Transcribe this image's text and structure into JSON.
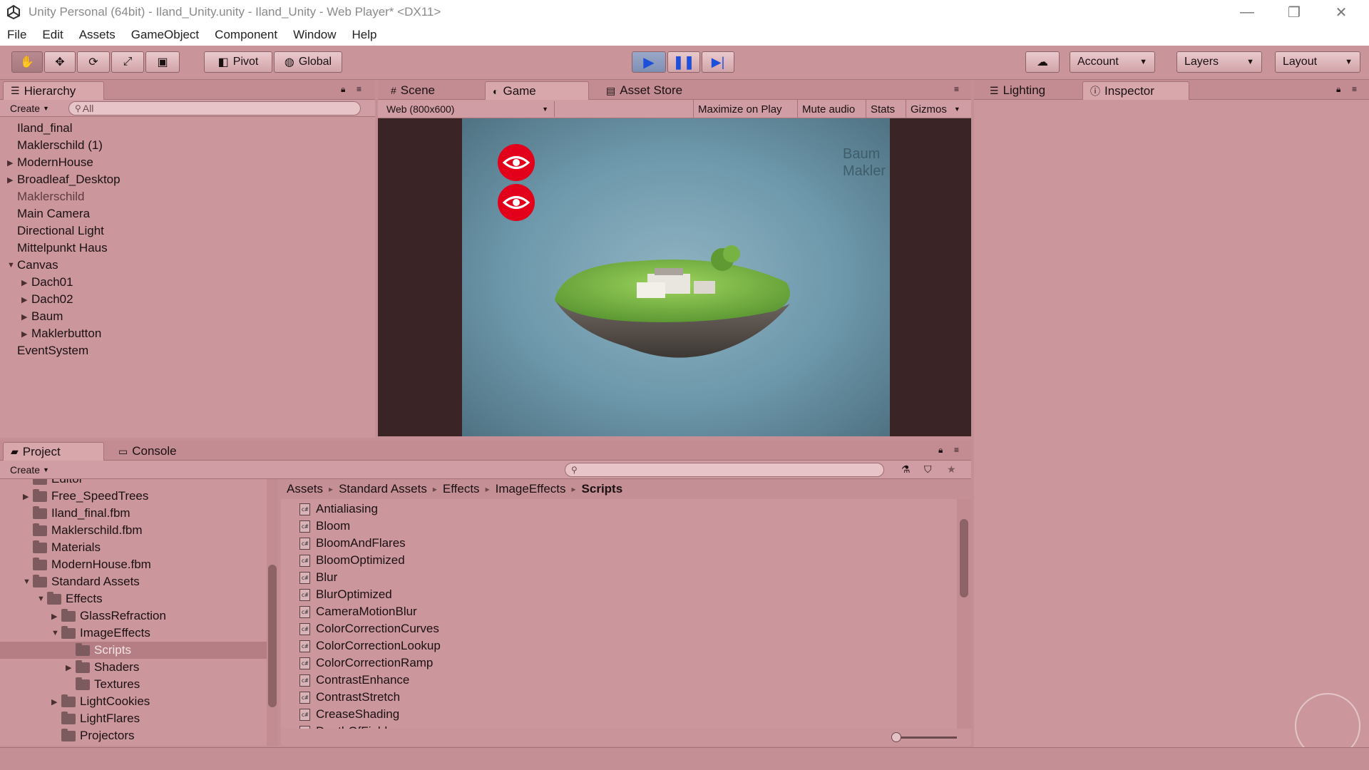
{
  "window": {
    "title": "Unity Personal (64bit) - Iland_Unity.unity - Iland_Unity - Web Player* <DX11>"
  },
  "menu": [
    "File",
    "Edit",
    "Assets",
    "GameObject",
    "Component",
    "Window",
    "Help"
  ],
  "toolbar": {
    "pivot": "Pivot",
    "global": "Global",
    "account": "Account",
    "layers": "Layers",
    "layout": "Layout"
  },
  "tabs": {
    "hierarchy": "Hierarchy",
    "scene": "Scene",
    "game": "Game",
    "asset_store": "Asset Store",
    "lighting": "Lighting",
    "inspector": "Inspector",
    "project": "Project",
    "console": "Console"
  },
  "hierarchy": {
    "create": "Create",
    "search_placeholder": "All",
    "items": [
      {
        "label": "Iland_final",
        "indent": 0,
        "arrow": "",
        "dim": false
      },
      {
        "label": "Maklerschild (1)",
        "indent": 0,
        "arrow": "",
        "dim": false
      },
      {
        "label": "ModernHouse",
        "indent": 0,
        "arrow": "▶",
        "dim": false
      },
      {
        "label": "Broadleaf_Desktop",
        "indent": 0,
        "arrow": "▶",
        "dim": false
      },
      {
        "label": "Maklerschild",
        "indent": 0,
        "arrow": "",
        "dim": true
      },
      {
        "label": "Main Camera",
        "indent": 0,
        "arrow": "",
        "dim": false
      },
      {
        "label": "Directional Light",
        "indent": 0,
        "arrow": "",
        "dim": false
      },
      {
        "label": "Mittelpunkt Haus",
        "indent": 0,
        "arrow": "",
        "dim": false
      },
      {
        "label": "Canvas",
        "indent": 0,
        "arrow": "▼",
        "dim": false
      },
      {
        "label": "Dach01",
        "indent": 1,
        "arrow": "▶",
        "dim": false
      },
      {
        "label": "Dach02",
        "indent": 1,
        "arrow": "▶",
        "dim": false
      },
      {
        "label": "Baum",
        "indent": 1,
        "arrow": "▶",
        "dim": false
      },
      {
        "label": "Maklerbutton",
        "indent": 1,
        "arrow": "▶",
        "dim": false
      },
      {
        "label": "EventSystem",
        "indent": 0,
        "arrow": "",
        "dim": false
      }
    ]
  },
  "game": {
    "resolution": "Web (800x600)",
    "maximize": "Maximize on Play",
    "mute": "Mute audio",
    "stats": "Stats",
    "gizmos": "Gizmos",
    "overlay_line1": "Baum",
    "overlay_line2": "Makler"
  },
  "project": {
    "create": "Create",
    "tree": [
      {
        "label": "Editor",
        "indent": 1,
        "arrow": ""
      },
      {
        "label": "Free_SpeedTrees",
        "indent": 1,
        "arrow": "▶"
      },
      {
        "label": "Iland_final.fbm",
        "indent": 1,
        "arrow": ""
      },
      {
        "label": "Maklerschild.fbm",
        "indent": 1,
        "arrow": ""
      },
      {
        "label": "Materials",
        "indent": 1,
        "arrow": ""
      },
      {
        "label": "ModernHouse.fbm",
        "indent": 1,
        "arrow": ""
      },
      {
        "label": "Standard Assets",
        "indent": 1,
        "arrow": "▼"
      },
      {
        "label": "Effects",
        "indent": 2,
        "arrow": "▼"
      },
      {
        "label": "GlassRefraction",
        "indent": 3,
        "arrow": "▶"
      },
      {
        "label": "ImageEffects",
        "indent": 3,
        "arrow": "▼"
      },
      {
        "label": "Scripts",
        "indent": 4,
        "arrow": "",
        "selected": true
      },
      {
        "label": "Shaders",
        "indent": 4,
        "arrow": "▶"
      },
      {
        "label": "Textures",
        "indent": 4,
        "arrow": ""
      },
      {
        "label": "LightCookies",
        "indent": 3,
        "arrow": "▶"
      },
      {
        "label": "LightFlares",
        "indent": 3,
        "arrow": ""
      },
      {
        "label": "Projectors",
        "indent": 3,
        "arrow": ""
      }
    ],
    "breadcrumb": [
      "Assets",
      "Standard Assets",
      "Effects",
      "ImageEffects",
      "Scripts"
    ],
    "files": [
      "Antialiasing",
      "Bloom",
      "BloomAndFlares",
      "BloomOptimized",
      "Blur",
      "BlurOptimized",
      "CameraMotionBlur",
      "ColorCorrectionCurves",
      "ColorCorrectionLookup",
      "ColorCorrectionRamp",
      "ContrastEnhance",
      "ContrastStretch",
      "CreaseShading",
      "DepthOfField"
    ]
  }
}
